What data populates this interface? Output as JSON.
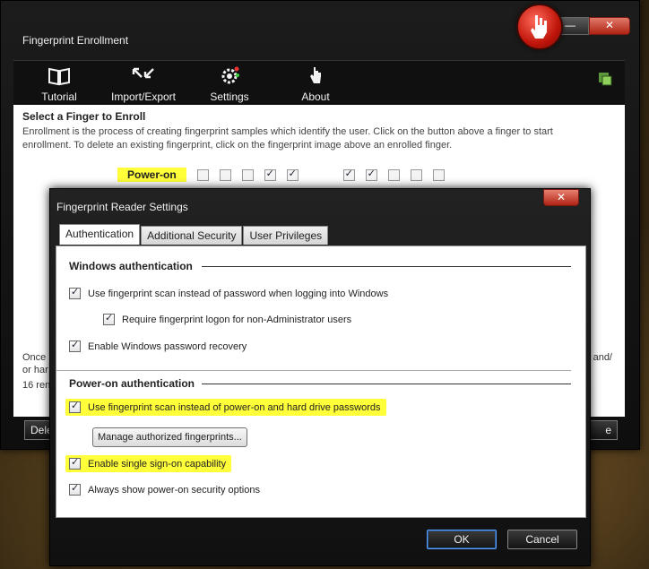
{
  "main_window": {
    "title": "Fingerprint Enrollment",
    "toolbar": [
      {
        "label": "Tutorial",
        "icon": "book-icon"
      },
      {
        "label": "Import/Export",
        "icon": "arrows-icon"
      },
      {
        "label": "Settings",
        "icon": "gear-icon"
      },
      {
        "label": "About",
        "icon": "hand-icon"
      }
    ],
    "heading": "Select a Finger to Enroll",
    "description": "Enrollment is the process of creating fingerprint samples which identify the user.  Click on the button above a finger to start enrollment.  To delete an existing fingerprint, click on the fingerprint image above an enrolled finger.",
    "poweron_label": "Power-on",
    "left_fingers": [
      false,
      false,
      false,
      true,
      true
    ],
    "right_fingers": [
      true,
      true,
      false,
      false,
      false
    ],
    "partial_text_1": "Once",
    "partial_text_2": "or har",
    "partial_text_3": "16 ren",
    "partial_text_right": "and/",
    "delete_button_partial": "Dele",
    "right_button_partial": "e",
    "minimize_label": "—",
    "close_label": "✕"
  },
  "dialog": {
    "title": "Fingerprint Reader Settings",
    "close_label": "✕",
    "tabs": [
      "Authentication",
      "Additional Security",
      "User Privileges"
    ],
    "windows_section": "Windows authentication",
    "windows_options": [
      {
        "label": "Use fingerprint scan instead of password when logging into Windows",
        "checked": true
      },
      {
        "label": "Require fingerprint logon for non-Administrator users",
        "checked": true
      },
      {
        "label": "Enable Windows password recovery",
        "checked": true
      }
    ],
    "poweron_section": "Power-on authentication",
    "poweron_options": [
      {
        "label": "Use fingerprint scan instead of power-on and hard drive passwords",
        "checked": true
      },
      {
        "label": "Enable single sign-on capability",
        "checked": true
      },
      {
        "label": "Always show power-on security options",
        "checked": true
      }
    ],
    "manage_button": "Manage authorized fingerprints...",
    "ok": "OK",
    "cancel": "Cancel"
  },
  "colors": {
    "highlight": "#ffff3a",
    "close_red": "#c0150a"
  }
}
